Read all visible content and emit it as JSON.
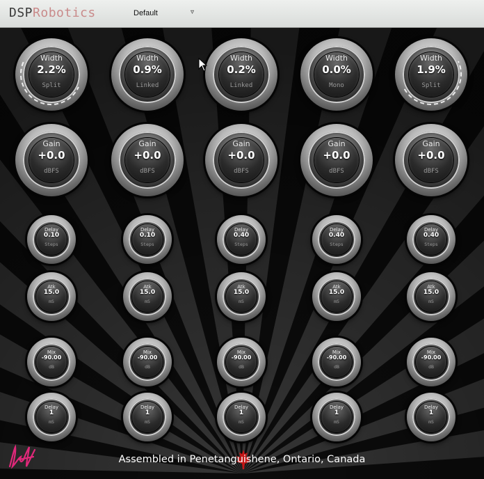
{
  "brand": {
    "part1": "DSP",
    "part2": "Robotics"
  },
  "preset": {
    "value": "Default",
    "arrow": "▿"
  },
  "colors": {
    "brand_accent": "#c98a8a",
    "panel_bg": "#0c0c0c",
    "signature": "#e0287a",
    "leaf": "#c41616"
  },
  "knob_rows": [
    {
      "type": "width",
      "knobs": [
        {
          "label": "Width",
          "value": "2.2%",
          "unit": "Split",
          "active": true
        },
        {
          "label": "Width",
          "value": "0.9%",
          "unit": "Linked",
          "active": false
        },
        {
          "label": "Width",
          "value": "0.2%",
          "unit": "Linked",
          "active": false
        },
        {
          "label": "Width",
          "value": "0.0%",
          "unit": "Mono",
          "active": false
        },
        {
          "label": "Width",
          "value": "1.9%",
          "unit": "Split",
          "active": true
        }
      ]
    },
    {
      "type": "gain",
      "knobs": [
        {
          "label": "Gain",
          "value": "+0.0",
          "unit": "dBFS"
        },
        {
          "label": "Gain",
          "value": "+0.0",
          "unit": "dBFS"
        },
        {
          "label": "Gain",
          "value": "+0.0",
          "unit": "dBFS"
        },
        {
          "label": "Gain",
          "value": "+0.0",
          "unit": "dBFS"
        },
        {
          "label": "Gain",
          "value": "+0.0",
          "unit": "dBFS"
        }
      ]
    },
    {
      "type": "delay-steps",
      "knobs": [
        {
          "label": "Delay",
          "value": "0.10",
          "unit": "Steps"
        },
        {
          "label": "Delay",
          "value": "0.10",
          "unit": "Steps"
        },
        {
          "label": "Delay",
          "value": "0.40",
          "unit": "Steps"
        },
        {
          "label": "Delay",
          "value": "0.40",
          "unit": "Steps"
        },
        {
          "label": "Delay",
          "value": "0.40",
          "unit": "Steps"
        }
      ]
    },
    {
      "type": "attack",
      "knobs": [
        {
          "label": "Atk",
          "value": "15.0",
          "unit": "mS"
        },
        {
          "label": "Atk",
          "value": "15.0",
          "unit": "mS"
        },
        {
          "label": "Atk",
          "value": "15.0",
          "unit": "mS"
        },
        {
          "label": "Atk",
          "value": "15.0",
          "unit": "mS"
        },
        {
          "label": "Atk",
          "value": "15.0",
          "unit": "mS"
        }
      ]
    },
    {
      "type": "mix",
      "knobs": [
        {
          "label": "Mix",
          "value": "-90.00",
          "unit": "dB"
        },
        {
          "label": "Mix",
          "value": "-90.00",
          "unit": "dB"
        },
        {
          "label": "Mix",
          "value": "-90.00",
          "unit": "dB"
        },
        {
          "label": "Mix",
          "value": "-90.00",
          "unit": "dB"
        },
        {
          "label": "Mix",
          "value": "-90.00",
          "unit": "dB"
        }
      ]
    },
    {
      "type": "delay-ms",
      "knobs": [
        {
          "label": "Delay",
          "value": "1",
          "unit": "mS"
        },
        {
          "label": "Delay",
          "value": "1",
          "unit": "mS"
        },
        {
          "label": "Delay",
          "value": "1",
          "unit": "mS"
        },
        {
          "label": "Delay",
          "value": "1",
          "unit": "mS"
        },
        {
          "label": "Delay",
          "value": "1",
          "unit": "mS"
        }
      ]
    }
  ],
  "footer": {
    "text": "Assembled in Penetanguishene, Ontario, Canada"
  },
  "icons": {
    "signature": "signature-icon",
    "leaf": "maple-leaf-icon",
    "cursor": "mouse-pointer-icon"
  }
}
